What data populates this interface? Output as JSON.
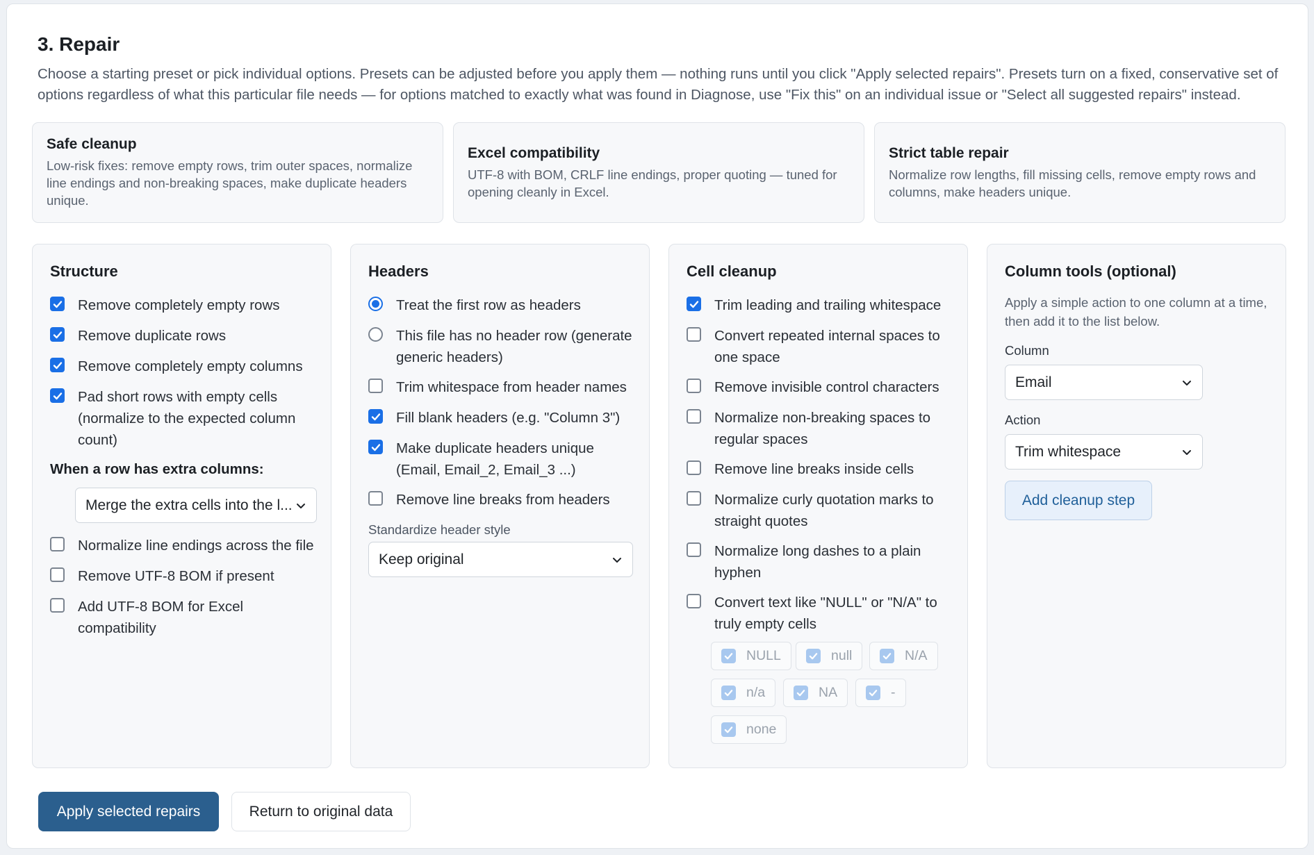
{
  "section": {
    "title": "3. Repair",
    "intro": "Choose a starting preset or pick individual options. Presets can be adjusted before you apply them — nothing runs until you click \"Apply selected repairs\". Presets turn on a fixed, conservative set of options regardless of what this particular file needs — for options matched to exactly what was found in Diagnose, use \"Fix this\" on an individual issue or \"Select all suggested repairs\" instead."
  },
  "presets": [
    {
      "title": "Safe cleanup",
      "desc": "Low-risk fixes: remove empty rows, trim outer spaces, normalize line endings and non-breaking spaces, make duplicate headers unique."
    },
    {
      "title": "Excel compatibility",
      "desc": "UTF-8 with BOM, CRLF line endings, proper quoting — tuned for opening cleanly in Excel."
    },
    {
      "title": "Strict table repair",
      "desc": "Normalize row lengths, fill missing cells, remove empty rows and columns, make headers unique."
    }
  ],
  "structure": {
    "title": "Structure",
    "options": [
      {
        "label": "Remove completely empty rows",
        "checked": true
      },
      {
        "label": "Remove duplicate rows",
        "checked": true
      },
      {
        "label": "Remove completely empty columns",
        "checked": true
      },
      {
        "label": "Pad short rows with empty cells (normalize to the expected column count)",
        "checked": true
      }
    ],
    "extra_label": "When a row has extra columns:",
    "extra_value": "Merge the extra cells into the l...",
    "options2": [
      {
        "label": "Normalize line endings across the file",
        "checked": false
      },
      {
        "label": "Remove UTF-8 BOM if present",
        "checked": false
      },
      {
        "label": "Add UTF-8 BOM for Excel compatibility",
        "checked": false
      }
    ]
  },
  "headers": {
    "title": "Headers",
    "radios": [
      {
        "label": "Treat the first row as headers",
        "selected": true
      },
      {
        "label": "This file has no header row (generate generic headers)",
        "selected": false
      }
    ],
    "options": [
      {
        "label": "Trim whitespace from header names",
        "checked": false
      },
      {
        "label": "Fill blank headers (e.g. \"Column 3\")",
        "checked": true
      },
      {
        "label": "Make duplicate headers unique (Email, Email_2, Email_3 ...)",
        "checked": true
      },
      {
        "label": "Remove line breaks from headers",
        "checked": false
      }
    ],
    "style_label": "Standardize header style",
    "style_value": "Keep original"
  },
  "cell_cleanup": {
    "title": "Cell cleanup",
    "options": [
      {
        "label": "Trim leading and trailing whitespace",
        "checked": true
      },
      {
        "label": "Convert repeated internal spaces to one space",
        "checked": false
      },
      {
        "label": "Remove invisible control characters",
        "checked": false
      },
      {
        "label": "Normalize non-breaking spaces to regular spaces",
        "checked": false
      },
      {
        "label": "Remove line breaks inside cells",
        "checked": false
      },
      {
        "label": "Normalize curly quotation marks to straight quotes",
        "checked": false
      },
      {
        "label": "Normalize long dashes to a plain hyphen",
        "checked": false
      },
      {
        "label": "Convert text like \"NULL\" or \"N/A\" to truly empty cells",
        "checked": false
      }
    ],
    "null_tokens": [
      "NULL",
      "null",
      "N/A",
      "n/a",
      "NA",
      "-",
      "none"
    ]
  },
  "column_tools": {
    "title": "Column tools (optional)",
    "help": "Apply a simple action to one column at a time, then add it to the list below.",
    "column_label": "Column",
    "column_value": "Email",
    "action_label": "Action",
    "action_value": "Trim whitespace",
    "add_button": "Add cleanup step"
  },
  "actions": {
    "apply": "Apply selected repairs",
    "return": "Return to original data"
  },
  "colors": {
    "accent": "#1a6fe6",
    "primary_button": "#2b5f8e",
    "soft_button": "#e7f0fb"
  }
}
